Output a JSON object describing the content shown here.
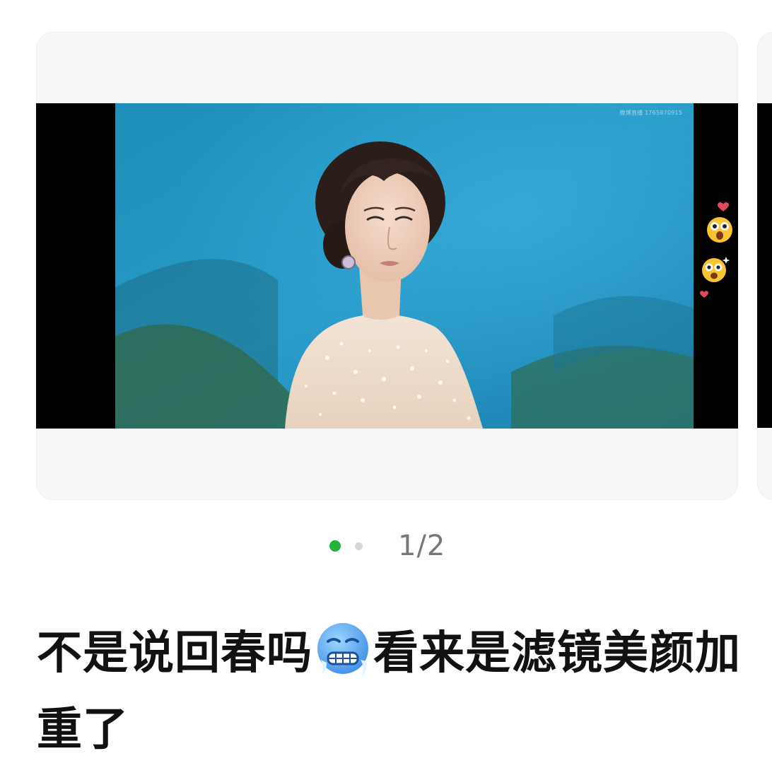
{
  "post": {
    "media": {
      "watermark": "微博直播 1765870915",
      "pager": {
        "current": 1,
        "total": 2,
        "label": "1/2"
      }
    },
    "caption": {
      "part1": "不是说回春吗",
      "emoji": "cold-face-emoji",
      "part2": "看来是滤镜美颜加重了"
    }
  },
  "colors": {
    "active_dot": "#22b43a",
    "inactive_dot": "#d6d6d6",
    "counter_text": "#777777",
    "caption_text": "#111111",
    "card_bg": "#f7f7f7"
  },
  "icons": [
    "heart-icon",
    "surprised-face-emoji",
    "starstruck-face-emoji",
    "cold-face-emoji"
  ]
}
